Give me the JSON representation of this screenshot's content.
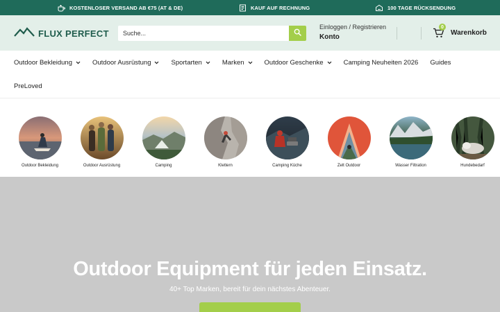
{
  "announcement": {
    "items": [
      {
        "text": "KOSTENLOSER VERSAND AB €75 (AT & DE)",
        "icon": "teapot-icon"
      },
      {
        "text": "KAUF AUF RECHNUNG",
        "icon": "invoice-icon"
      },
      {
        "text": "100 TAGE RÜCKSENDUNG",
        "icon": "return-box-icon"
      }
    ]
  },
  "header": {
    "logo": "FLUX PERFECT",
    "search_placeholder": "Suche...",
    "account_top": "Einloggen / Registrieren",
    "account_bottom": "Konto",
    "cart_count": "0",
    "cart_label": "Warenkorb"
  },
  "nav": {
    "row1": [
      {
        "label": "Outdoor Bekleidung",
        "dropdown": true
      },
      {
        "label": "Outdoor Ausrüstung",
        "dropdown": true
      },
      {
        "label": "Sportarten",
        "dropdown": true
      },
      {
        "label": "Marken",
        "dropdown": true
      },
      {
        "label": "Outdoor Geschenke",
        "dropdown": true
      },
      {
        "label": "Camping Neuheiten 2026",
        "dropdown": false
      },
      {
        "label": "Guides",
        "dropdown": false
      }
    ],
    "row2": [
      {
        "label": "PreLoved",
        "dropdown": false
      }
    ]
  },
  "categories": [
    {
      "label": "Outdoor Bekleidung"
    },
    {
      "label": "Outdoor Ausrüstung"
    },
    {
      "label": "Camping"
    },
    {
      "label": "Klettern"
    },
    {
      "label": "Camping Küche"
    },
    {
      "label": "Zelt Outdoor"
    },
    {
      "label": "Wasser Filtration"
    },
    {
      "label": "Hundebedarf"
    }
  ],
  "hero": {
    "title": "Outdoor Equipment für jeden Einsatz.",
    "subtitle": "40+ Top Marken, bereit für dein nächstes Abenteuer."
  },
  "colors": {
    "brand_dark": "#1f6b5a",
    "header_bg": "#e3efe9",
    "accent_lime": "#a3ce4a",
    "hero_bg": "#c9c9c9"
  }
}
